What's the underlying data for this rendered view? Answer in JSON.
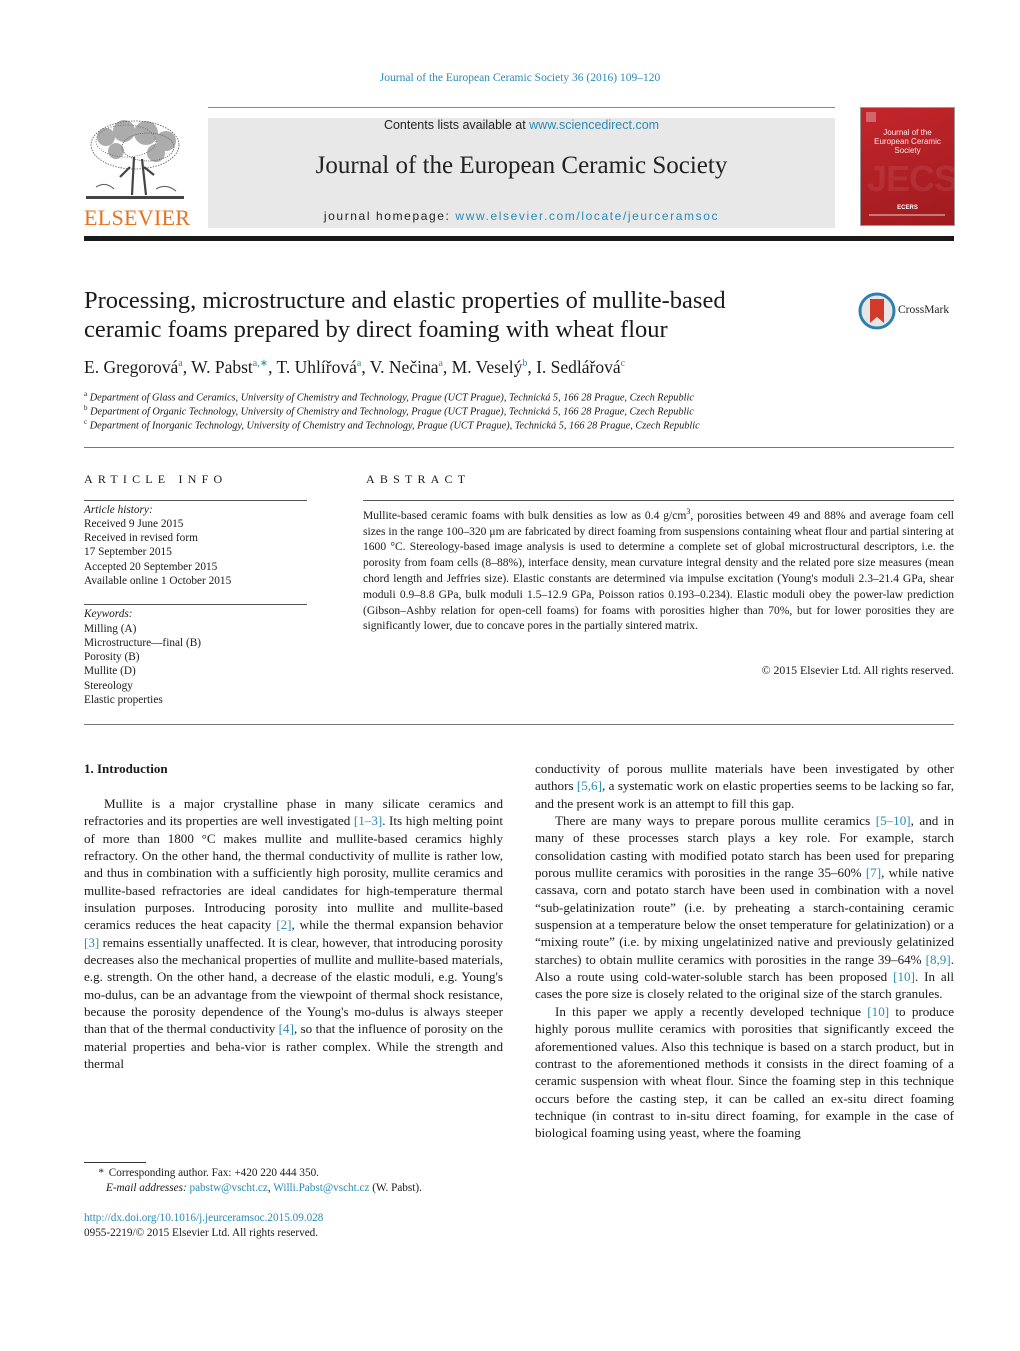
{
  "citation": "Journal of the European Ceramic Society 36 (2016) 109–120",
  "header": {
    "publisher_logo_text": "ELSEVIER",
    "contents_prefix": "Contents lists available at ",
    "contents_link": "www.sciencedirect.com",
    "journal_name": "Journal of the European Ceramic Society",
    "homepage_prefix": "journal homepage: ",
    "homepage_link": "www.elsevier.com/locate/jeurceramsoc",
    "cover": {
      "title_line1": "Journal of the",
      "title_line2": "European Ceramic Society",
      "watermark": "JECS",
      "society": "ECERS"
    },
    "colors": {
      "link": "#2a8bb5",
      "elsevier_orange": "#e9711c",
      "cover_red": "#c4262b"
    }
  },
  "article": {
    "title_line1": "Processing, microstructure and elastic properties of mullite-based",
    "title_line2": "ceramic foams prepared by direct foaming with wheat flour",
    "crossmark_label": "CrossMark",
    "authors": [
      {
        "name": "E. Gregorová",
        "sup": "a",
        "sep": ", "
      },
      {
        "name": "W. Pabst",
        "sup": "a,∗",
        "sep": ", "
      },
      {
        "name": "T. Uhlířová",
        "sup": "a",
        "sep": ", "
      },
      {
        "name": "V. Nečina",
        "sup": "a",
        "sep": ", "
      },
      {
        "name": "M. Veselý",
        "sup": "b",
        "sep": ", "
      },
      {
        "name": "I. Sedlářová",
        "sup": "c",
        "sep": ""
      }
    ],
    "affiliations": [
      {
        "mark": "a",
        "text": "Department of Glass and Ceramics, University of Chemistry and Technology, Prague (UCT Prague), Technická 5, 166 28 Prague, Czech Republic"
      },
      {
        "mark": "b",
        "text": "Department of Organic Technology, University of Chemistry and Technology, Prague (UCT Prague), Technická 5, 166 28 Prague, Czech Republic"
      },
      {
        "mark": "c",
        "text": "Department of Inorganic Technology, University of Chemistry and Technology, Prague (UCT Prague), Technická 5, 166 28 Prague, Czech Republic"
      }
    ]
  },
  "article_info": {
    "heading": "ARTICLE INFO",
    "history_label": "Article history:",
    "history": [
      "Received 9 June 2015",
      "Received in revised form",
      "17 September 2015",
      "Accepted 20 September 2015",
      "Available online 1 October 2015"
    ],
    "keywords_label": "Keywords:",
    "keywords": [
      "Milling (A)",
      "Microstructure—final (B)",
      "Porosity (B)",
      "Mullite (D)",
      "Stereology",
      "Elastic properties"
    ]
  },
  "abstract": {
    "heading": "ABSTRACT",
    "text_part1": "Mullite-based ceramic foams with bulk densities as low as 0.4 g/cm",
    "text_sup": "3",
    "text_part2": ", porosities between 49 and 88% and average foam cell sizes in the range 100–320 μm are fabricated by direct foaming from suspensions containing wheat flour and partial sintering at 1600 °C. Stereology-based image analysis is used to determine a complete set of global microstructural descriptors, i.e. the porosity from foam cells (8–88%), interface density, mean curvature integral density and the related pore size measures (mean chord length and Jeffries size). Elastic constants are determined via impulse excitation (Young's moduli 2.3–21.4 GPa, shear moduli 0.9–8.8 GPa, bulk moduli 1.5–12.9 GPa, Poisson ratios 0.193–0.234). Elastic moduli obey the power-law prediction (Gibson–Ashby relation for open-cell foams) for foams with porosities higher than 70%, but for lower porosities they are significantly lower, due to concave pores in the partially sintered matrix.",
    "copyright": "© 2015 Elsevier Ltd. All rights reserved."
  },
  "body": {
    "section_heading": "1.  Introduction",
    "left_p1": [
      {
        "t": "Mullite is a major crystalline phase in many silicate ceramics and refractories and its properties are well investigated "
      },
      {
        "ref": "[1–3]"
      },
      {
        "t": ". Its high melting point of more than 1800 °C makes mullite and mullite-based ceramics highly refractory. On the other hand, the thermal conductivity of mullite is rather low, and thus in combination with a sufficiently high porosity, mullite ceramics and mullite-based refractories are ideal candidates for high-temperature thermal insulation purposes. Introducing porosity into mullite and mullite-based ceramics reduces the heat capacity "
      },
      {
        "ref": "[2]"
      },
      {
        "t": ", while the thermal expansion behavior "
      },
      {
        "ref": "[3]"
      },
      {
        "t": " remains essentially unaffected. It is clear, however, that introducing porosity decreases also the mechanical properties of mullite and mullite-based materials, e.g. strength. On the other hand, a decrease of the elastic moduli, e.g. Young's mo-dulus, can be an advantage from the viewpoint of thermal shock resistance, because the porosity dependence of the Young's mo-dulus is always steeper than that of the thermal conductivity "
      },
      {
        "ref": "[4]"
      },
      {
        "t": ", so that the influence of porosity on the material properties and beha-vior is rather complex. While the strength and thermal"
      }
    ],
    "right_p1": [
      {
        "t": "conductivity of porous mullite materials have been investigated by other authors "
      },
      {
        "ref": "[5,6]"
      },
      {
        "t": ", a systematic work on elastic properties seems to be lacking so far, and the present work is an attempt to fill this gap."
      }
    ],
    "right_p2": [
      {
        "t": "There are many ways to prepare porous mullite ceramics "
      },
      {
        "ref": "[5–10]"
      },
      {
        "t": ", and in many of these processes starch plays a key role. For example, starch consolidation casting with modified potato starch has been used for preparing porous mullite ceramics with porosities in the range 35–60% "
      },
      {
        "ref": "[7]"
      },
      {
        "t": ", while native cassava, corn and potato starch have been used in combination with a novel “sub-gelatinization route” (i.e. by preheating a starch-containing ceramic suspension at a temperature below the onset temperature for gelatinization) or a “mixing route” (i.e. by mixing ungelatinized native and previously gelatinized starches) to obtain mullite ceramics with porosities in the range 39–64% "
      },
      {
        "ref": "[8,9]"
      },
      {
        "t": ". Also a route using cold-water-soluble starch has been proposed "
      },
      {
        "ref": "[10]"
      },
      {
        "t": ". In all cases the pore size is closely related to the original size of the starch granules."
      }
    ],
    "right_p3": [
      {
        "t": "In this paper we apply a recently developed technique "
      },
      {
        "ref": "[10]"
      },
      {
        "t": " to produce highly porous mullite ceramics with porosities that significantly exceed the aforementioned values. Also this technique is based on a starch product, but in contrast to the aforementioned methods it consists in the direct foaming of a ceramic suspension with wheat flour. Since the foaming step in this technique occurs before the casting step, it can be called an ex-situ direct foaming technique (in contrast to in-situ direct foaming, for example in the case of biological foaming using yeast, where the foaming"
      }
    ]
  },
  "footnote": {
    "star": "*",
    "corresponding": "Corresponding author. Fax: +420 220 444 350.",
    "emails_label": "E-mail addresses:",
    "email1": "pabstw@vscht.cz",
    "email_sep": ", ",
    "email2": "Willi.Pabst@vscht.cz",
    "emails_suffix": " (W. Pabst).",
    "doi": "http://dx.doi.org/10.1016/j.jeurceramsoc.2015.09.028",
    "issn_line": "0955-2219/© 2015 Elsevier Ltd. All rights reserved."
  }
}
